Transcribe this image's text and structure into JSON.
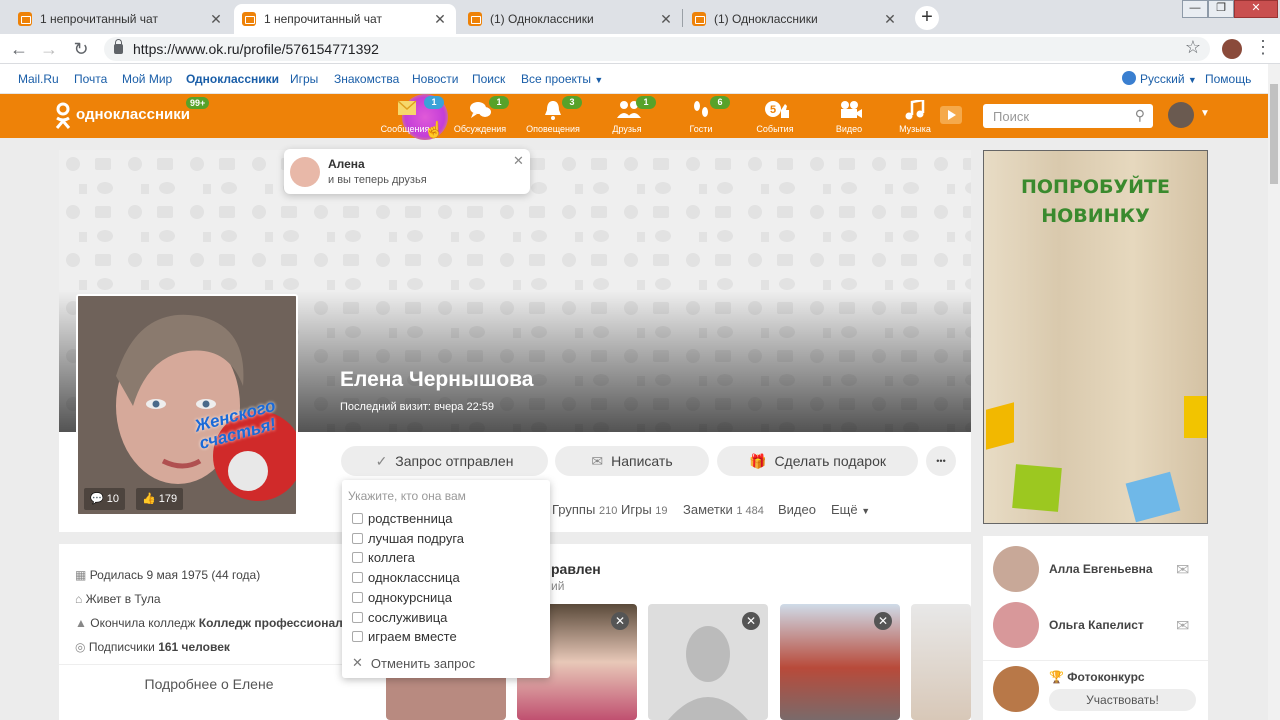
{
  "browser": {
    "tabs": [
      {
        "title": "1 непрочитанный чат",
        "close": "✕"
      },
      {
        "title": "1 непрочитанный чат",
        "close": "✕"
      },
      {
        "title": "(1) Одноклассники",
        "close": "✕"
      },
      {
        "title": "(1) Одноклассники",
        "close": "✕"
      }
    ],
    "new_tab": "+",
    "url": "https://www.ok.ru/profile/576154771392"
  },
  "portal": {
    "links": [
      "Mail.Ru",
      "Почта",
      "Мой Мир",
      "Одноклассники",
      "Игры",
      "Знакомства",
      "Новости",
      "Поиск",
      "Все проекты"
    ],
    "language": "Русский",
    "help": "Помощь"
  },
  "toolbar": {
    "logo": "одноклассники",
    "logo_badge": "99+",
    "items": [
      {
        "label": "Сообщения",
        "badge": "1",
        "icon": "envelope-icon"
      },
      {
        "label": "Обсуждения",
        "badge": "1",
        "icon": "chat-bubbles-icon"
      },
      {
        "label": "Оповещения",
        "badge": "3",
        "icon": "bell-icon"
      },
      {
        "label": "Друзья",
        "badge": "1",
        "icon": "friends-icon"
      },
      {
        "label": "Гости",
        "badge": "6",
        "icon": "footprints-icon"
      },
      {
        "label": "События",
        "badge": "",
        "icon": "events-icon"
      },
      {
        "label": "Видео",
        "badge": "",
        "icon": "video-camera-icon"
      },
      {
        "label": "Музыка",
        "badge": "",
        "icon": "music-note-icon"
      }
    ],
    "search_placeholder": "Поиск"
  },
  "notification": {
    "name": "Алена",
    "text": "и вы теперь друзья"
  },
  "profile": {
    "name": "Елена Чернышова",
    "last_visit": "Последний визит: вчера 22:59",
    "avatar_comments": "10",
    "avatar_likes": "179",
    "avatar_sticker": "Женского счастья!",
    "buttons": {
      "request_sent": "Запрос отправлен",
      "write": "Написать",
      "gift": "Сделать подарок",
      "more": "•••"
    },
    "tabs": [
      {
        "label": "Группы",
        "count": "210"
      },
      {
        "label": "Игры",
        "count": "19"
      },
      {
        "label": "Заметки",
        "count": "1 484"
      },
      {
        "label": "Видео",
        "count": ""
      },
      {
        "label": "Ещё",
        "count": ""
      }
    ]
  },
  "relation_dropdown": {
    "header": "Укажите, кто она вам",
    "options": [
      "родственница",
      "лучшая подруга",
      "коллега",
      "одноклассница",
      "однокурсница",
      "сослуживица",
      "играем вместе"
    ],
    "cancel": "Отменить запрос"
  },
  "info": {
    "born": "Родилась 9 мая 1975 (44 года)",
    "lives": "Живет в Тула",
    "college_prefix": "Окончила колледж ",
    "college_name": "Колледж профессионал...",
    "subscribers_prefix": "Подписчики ",
    "subscribers_count": "161 человек",
    "more": "Подробнее о Елене"
  },
  "feed": {
    "title_partial": "равлен",
    "subtitle_partial": "ий"
  },
  "ad": {
    "line1": "ПОПРОБУЙТЕ",
    "line2": "НОВИНКУ"
  },
  "friends": [
    {
      "name": "Алла Евгеньевна"
    },
    {
      "name": "Ольга Капелист"
    }
  ],
  "contest": {
    "title": "Фотоконкурс",
    "button": "Участвовать!"
  },
  "colors": {
    "ok_orange": "#ee8208",
    "badge_green": "#57a22a",
    "link_blue": "#1a5ea8",
    "ad_green": "#3a8a2e"
  }
}
